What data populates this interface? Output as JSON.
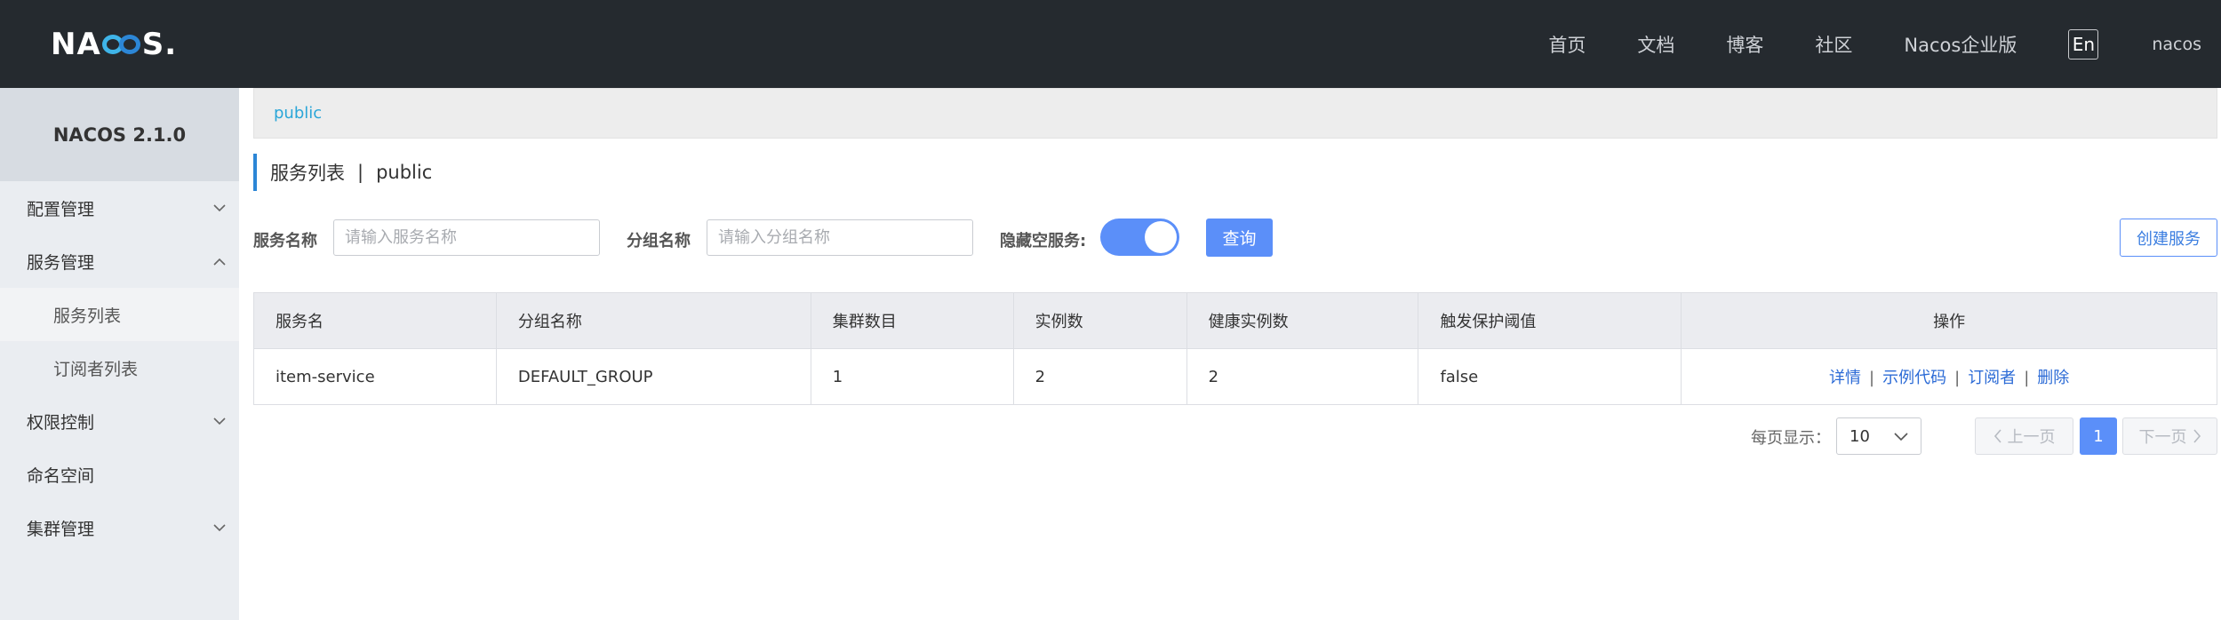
{
  "header": {
    "logo_text_left": "NA",
    "logo_text_right": "S",
    "logo_dot": ".",
    "nav": [
      "首页",
      "文档",
      "博客",
      "社区",
      "Nacos企业版"
    ],
    "lang_button": "En",
    "user": "nacos"
  },
  "sidebar": {
    "title": "NACOS 2.1.0",
    "items": [
      {
        "label": "配置管理",
        "chevron": "chevron-down-icon"
      },
      {
        "label": "服务管理",
        "chevron": "chevron-up-icon"
      },
      {
        "label": "服务列表"
      },
      {
        "label": "订阅者列表"
      },
      {
        "label": "权限控制",
        "chevron": "chevron-down-icon"
      },
      {
        "label": "命名空间"
      },
      {
        "label": "集群管理",
        "chevron": "chevron-down-icon"
      }
    ]
  },
  "breadcrumb": "public",
  "page_title": {
    "main": "服务列表",
    "sep": "|",
    "namespace": "public"
  },
  "filters": {
    "service_name_label": "服务名称",
    "service_name_placeholder": "请输入服务名称",
    "group_name_label": "分组名称",
    "group_name_placeholder": "请输入分组名称",
    "hide_empty_label": "隐藏空服务:",
    "hide_empty_on": true,
    "query_button": "查询",
    "create_button": "创建服务"
  },
  "table": {
    "headers": [
      "服务名",
      "分组名称",
      "集群数目",
      "实例数",
      "健康实例数",
      "触发保护阈值",
      "操作"
    ],
    "rows": [
      {
        "service": "item-service",
        "group": "DEFAULT_GROUP",
        "clusters": "1",
        "instances": "2",
        "healthy": "2",
        "threshold": "false",
        "ops": [
          "详情",
          "示例代码",
          "订阅者",
          "删除"
        ],
        "op_sep": "|"
      }
    ]
  },
  "pagination": {
    "page_size_label": "每页显示：",
    "page_size": "10",
    "prev": "上一页",
    "current": "1",
    "next": "下一页"
  },
  "colors": {
    "header_bg": "#252a2f",
    "primary": "#5b8ff9",
    "link": "#2c6bd6",
    "breadcrumb": "#2aa6d8"
  }
}
